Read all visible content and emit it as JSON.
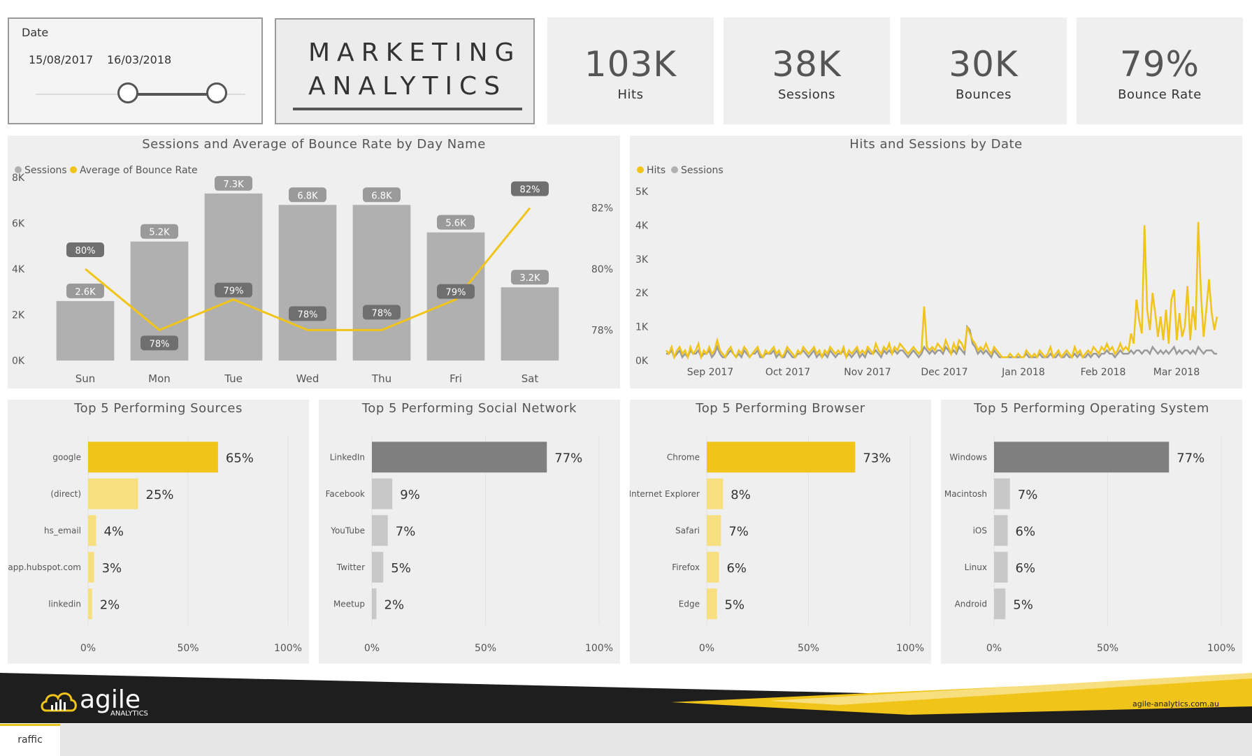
{
  "date_slicer": {
    "label": "Date",
    "start": "15/08/2017",
    "end": "16/03/2018"
  },
  "title": {
    "line1": "MARKETING",
    "line2": "ANALYTICS"
  },
  "kpis": [
    {
      "value": "103K",
      "label": "Hits"
    },
    {
      "value": "38K",
      "label": "Sessions"
    },
    {
      "value": "30K",
      "label": "Bounces"
    },
    {
      "value": "79%",
      "label": "Bounce Rate"
    }
  ],
  "colors": {
    "yellow": "#f0c419",
    "light_yellow": "#f7df80",
    "dark_gray": "#7f7f7f",
    "gray": "#b0b0b0",
    "light_gray": "#c8c8c8"
  },
  "chart_data": [
    {
      "type": "bar",
      "title": "Sessions and Average of Bounce Rate by Day Name",
      "legend": [
        "Sessions",
        "Average of Bounce Rate"
      ],
      "categories": [
        "Sun",
        "Mon",
        "Tue",
        "Wed",
        "Thu",
        "Fri",
        "Sat"
      ],
      "series": [
        {
          "name": "Sessions",
          "values": [
            2.6,
            5.2,
            7.3,
            6.8,
            6.8,
            5.6,
            3.2
          ],
          "labels": [
            "2.6K",
            "5.2K",
            "7.3K",
            "6.8K",
            "6.8K",
            "5.6K",
            "3.2K"
          ]
        },
        {
          "name": "Average of Bounce Rate",
          "type": "line",
          "values": [
            80,
            78,
            79,
            78,
            78,
            79,
            82
          ],
          "labels": [
            "80%",
            "78%",
            "79%",
            "78%",
            "78%",
            "79%",
            "82%"
          ]
        }
      ],
      "yticks": [
        "0K",
        "2K",
        "4K",
        "6K",
        "8K"
      ],
      "y2ticks": [
        "78%",
        "80%",
        "82%"
      ],
      "ylim": [
        0,
        8
      ]
    },
    {
      "type": "line",
      "title": "Hits and Sessions by Date",
      "legend": [
        "Hits",
        "Sessions"
      ],
      "xticks": [
        "Sep 2017",
        "Oct 2017",
        "Nov 2017",
        "Dec 2017",
        "Jan 2018",
        "Feb 2018",
        "Mar 2018"
      ],
      "yticks": [
        "0K",
        "1K",
        "2K",
        "3K",
        "4K",
        "5K"
      ],
      "ylim": [
        0,
        5
      ],
      "series": [
        {
          "name": "Hits",
          "values": [
            0.3,
            0.2,
            0.4,
            0.1,
            0.3,
            0.4,
            0.2,
            0.3,
            0.1,
            0.4,
            0.2,
            0.3,
            0.5,
            0.1,
            0.3,
            0.2,
            0.4,
            0.2,
            0.3,
            0.6,
            0.3,
            0.2,
            0.1,
            0.3,
            0.4,
            0.2,
            0.1,
            0.3,
            0.2,
            0.4,
            0.3,
            0.1,
            0.2,
            0.3,
            0.4,
            0.2,
            0.1,
            0.3,
            0.2,
            0.3,
            0.4,
            0.2,
            0.3,
            0.1,
            0.2,
            0.4,
            0.3,
            0.2,
            0.1,
            0.3,
            0.2,
            0.4,
            0.3,
            0.2,
            0.3,
            0.4,
            0.2,
            0.3,
            0.1,
            0.3,
            0.2,
            0.4,
            0.3,
            0.2,
            0.3,
            0.2,
            0.4,
            0.1,
            0.3,
            0.2,
            0.3,
            0.4,
            0.2,
            0.3,
            0.2,
            0.4,
            0.3,
            0.2,
            0.5,
            0.3,
            0.2,
            0.4,
            0.3,
            0.5,
            0.2,
            0.4,
            0.3,
            0.5,
            0.4,
            0.3,
            0.2,
            0.3,
            0.4,
            0.3,
            0.2,
            0.3,
            1.6,
            0.4,
            0.3,
            0.4,
            0.3,
            0.5,
            0.4,
            0.3,
            0.6,
            0.4,
            0.2,
            0.5,
            0.3,
            0.6,
            0.5,
            0.3,
            1.0,
            0.8,
            0.6,
            0.5,
            0.3,
            0.4,
            0.3,
            0.5,
            0.3,
            0.2,
            0.4,
            0.3,
            0.2,
            0.1,
            0.1,
            0.1,
            0.2,
            0.1,
            0.1,
            0.2,
            0.1,
            0.1,
            0.3,
            0.2,
            0.1,
            0.2,
            0.1,
            0.3,
            0.2,
            0.1,
            0.2,
            0.4,
            0.1,
            0.2,
            0.3,
            0.1,
            0.2,
            0.3,
            0.2,
            0.1,
            0.4,
            0.2,
            0.3,
            0.1,
            0.2,
            0.3,
            0.2,
            0.4,
            0.3,
            0.2,
            0.4,
            0.3,
            0.5,
            0.3,
            0.4,
            0.2,
            0.3,
            0.5,
            0.3,
            0.4,
            0.3,
            0.8,
            0.5,
            1.8,
            1.2,
            0.8,
            4.0,
            1.5,
            0.9,
            2.0,
            1.4,
            0.7,
            1.3,
            0.6,
            1.5,
            0.5,
            1.8,
            2.1,
            0.6,
            1.4,
            0.7,
            1.0,
            2.2,
            0.6,
            1.6,
            0.9,
            4.1,
            2.0,
            0.7,
            1.5,
            2.4,
            1.4,
            0.9,
            1.3
          ]
        },
        {
          "name": "Sessions",
          "values": [
            0.2,
            0.2,
            0.3,
            0.1,
            0.2,
            0.3,
            0.1,
            0.2,
            0.1,
            0.3,
            0.2,
            0.2,
            0.3,
            0.1,
            0.2,
            0.2,
            0.3,
            0.1,
            0.2,
            0.4,
            0.2,
            0.1,
            0.1,
            0.2,
            0.3,
            0.2,
            0.1,
            0.2,
            0.1,
            0.3,
            0.2,
            0.1,
            0.2,
            0.2,
            0.3,
            0.1,
            0.1,
            0.2,
            0.2,
            0.2,
            0.3,
            0.1,
            0.2,
            0.1,
            0.1,
            0.3,
            0.2,
            0.1,
            0.1,
            0.2,
            0.2,
            0.3,
            0.2,
            0.1,
            0.2,
            0.3,
            0.1,
            0.2,
            0.1,
            0.2,
            0.1,
            0.3,
            0.2,
            0.1,
            0.2,
            0.2,
            0.3,
            0.1,
            0.2,
            0.1,
            0.2,
            0.3,
            0.1,
            0.2,
            0.1,
            0.3,
            0.2,
            0.2,
            0.3,
            0.2,
            0.1,
            0.3,
            0.2,
            0.3,
            0.2,
            0.3,
            0.2,
            0.3,
            0.3,
            0.2,
            0.1,
            0.2,
            0.3,
            0.2,
            0.1,
            0.2,
            0.4,
            0.3,
            0.2,
            0.3,
            0.2,
            0.3,
            0.3,
            0.2,
            0.4,
            0.3,
            0.2,
            0.3,
            0.2,
            0.4,
            0.3,
            0.2,
            1.0,
            0.9,
            0.5,
            0.4,
            0.2,
            0.3,
            0.2,
            0.3,
            0.2,
            0.1,
            0.3,
            0.2,
            0.1,
            0.1,
            0.1,
            0.1,
            0.1,
            0.1,
            0.1,
            0.1,
            0.1,
            0.1,
            0.2,
            0.1,
            0.1,
            0.1,
            0.1,
            0.2,
            0.1,
            0.1,
            0.1,
            0.2,
            0.1,
            0.1,
            0.2,
            0.1,
            0.1,
            0.2,
            0.1,
            0.1,
            0.2,
            0.1,
            0.2,
            0.1,
            0.1,
            0.2,
            0.1,
            0.2,
            0.2,
            0.1,
            0.2,
            0.2,
            0.3,
            0.2,
            0.2,
            0.1,
            0.2,
            0.3,
            0.2,
            0.2,
            0.2,
            0.3,
            0.2,
            0.3,
            0.3,
            0.2,
            0.3,
            0.3,
            0.2,
            0.4,
            0.3,
            0.2,
            0.3,
            0.2,
            0.3,
            0.2,
            0.3,
            0.4,
            0.2,
            0.3,
            0.2,
            0.3,
            0.3,
            0.2,
            0.3,
            0.2,
            0.4,
            0.3,
            0.2,
            0.3,
            0.3,
            0.3,
            0.2,
            0.2
          ]
        }
      ]
    },
    {
      "type": "bar",
      "orientation": "horizontal",
      "title": "Top 5 Performing Sources",
      "categories": [
        "google",
        "(direct)",
        "hs_email",
        "app.hubspot.com",
        "linkedin"
      ],
      "values": [
        65,
        25,
        4,
        3,
        2
      ],
      "labels": [
        "65%",
        "25%",
        "4%",
        "3%",
        "2%"
      ],
      "bar_colors": [
        "#f0c419",
        "#f7df80",
        "#f7df80",
        "#f7df80",
        "#f7df80"
      ],
      "xticks": [
        "0%",
        "50%",
        "100%"
      ],
      "xlim": [
        0,
        100
      ]
    },
    {
      "type": "bar",
      "orientation": "horizontal",
      "title": "Top 5 Performing Social Network",
      "categories": [
        "LinkedIn",
        "Facebook",
        "YouTube",
        "Twitter",
        "Meetup"
      ],
      "values": [
        77,
        9,
        7,
        5,
        2
      ],
      "labels": [
        "77%",
        "9%",
        "7%",
        "5%",
        "2%"
      ],
      "bar_colors": [
        "#7f7f7f",
        "#c8c8c8",
        "#c8c8c8",
        "#c8c8c8",
        "#c8c8c8"
      ],
      "xticks": [
        "0%",
        "50%",
        "100%"
      ],
      "xlim": [
        0,
        100
      ]
    },
    {
      "type": "bar",
      "orientation": "horizontal",
      "title": "Top 5 Performing Browser",
      "categories": [
        "Chrome",
        "Internet Explorer",
        "Safari",
        "Firefox",
        "Edge"
      ],
      "values": [
        73,
        8,
        7,
        6,
        5
      ],
      "labels": [
        "73%",
        "8%",
        "7%",
        "6%",
        "5%"
      ],
      "bar_colors": [
        "#f0c419",
        "#f7df80",
        "#f7df80",
        "#f7df80",
        "#f7df80"
      ],
      "xticks": [
        "0%",
        "50%",
        "100%"
      ],
      "xlim": [
        0,
        100
      ]
    },
    {
      "type": "bar",
      "orientation": "horizontal",
      "title": "Top 5 Performing Operating System",
      "categories": [
        "Windows",
        "Macintosh",
        "iOS",
        "Linux",
        "Android"
      ],
      "values": [
        77,
        7,
        6,
        6,
        5
      ],
      "labels": [
        "77%",
        "7%",
        "6%",
        "6%",
        "5%"
      ],
      "bar_colors": [
        "#7f7f7f",
        "#c8c8c8",
        "#c8c8c8",
        "#c8c8c8",
        "#c8c8c8"
      ],
      "xticks": [
        "0%",
        "50%",
        "100%"
      ],
      "xlim": [
        0,
        100
      ]
    }
  ],
  "footer": {
    "brand": "agile",
    "brand_sub": "ANALYTICS",
    "url": "agile-analytics.com.au"
  },
  "tabs": [
    {
      "label": "raffic"
    }
  ]
}
